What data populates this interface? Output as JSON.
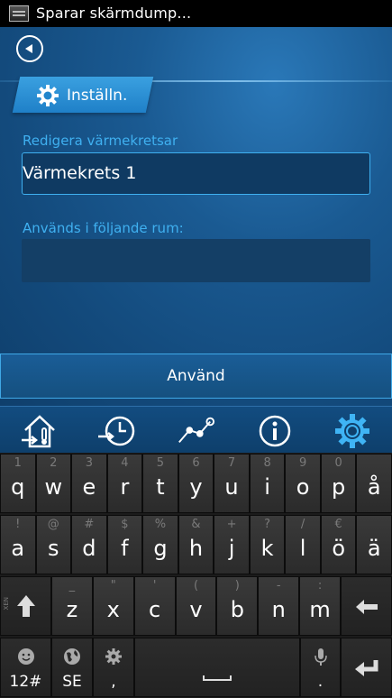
{
  "status_bar": {
    "notification_text": "Sparar skärmdump..."
  },
  "header": {
    "tab_label": "Inställn."
  },
  "form": {
    "edit_label": "Redigera värmekretsar",
    "circuit_name": "Värmekrets 1",
    "rooms_label": "Används i följande rum:",
    "rooms_value": ""
  },
  "apply_button": {
    "label": "Använd"
  },
  "nav": {
    "items": [
      {
        "icon": "house-thermometer-icon"
      },
      {
        "icon": "schedule-clock-icon"
      },
      {
        "icon": "graph-curve-icon"
      },
      {
        "icon": "info-icon"
      },
      {
        "icon": "settings-gear-icon",
        "active": true
      }
    ],
    "active_color": "#3fb4f5"
  },
  "keyboard": {
    "row1": [
      {
        "key": "q",
        "alt": "1"
      },
      {
        "key": "w",
        "alt": "2"
      },
      {
        "key": "e",
        "alt": "3"
      },
      {
        "key": "r",
        "alt": "4"
      },
      {
        "key": "t",
        "alt": "5"
      },
      {
        "key": "y",
        "alt": "6"
      },
      {
        "key": "u",
        "alt": "7"
      },
      {
        "key": "i",
        "alt": "8"
      },
      {
        "key": "o",
        "alt": "9"
      },
      {
        "key": "p",
        "alt": "0"
      },
      {
        "key": "å",
        "alt": ""
      }
    ],
    "row2": [
      {
        "key": "a",
        "alt": "!"
      },
      {
        "key": "s",
        "alt": "@"
      },
      {
        "key": "d",
        "alt": "#"
      },
      {
        "key": "f",
        "alt": "$"
      },
      {
        "key": "g",
        "alt": "%"
      },
      {
        "key": "h",
        "alt": "&"
      },
      {
        "key": "j",
        "alt": "+"
      },
      {
        "key": "k",
        "alt": "?"
      },
      {
        "key": "l",
        "alt": "/"
      },
      {
        "key": "ö",
        "alt": "€"
      },
      {
        "key": "ä",
        "alt": ""
      }
    ],
    "row3": [
      {
        "key": "z",
        "alt": "_"
      },
      {
        "key": "x",
        "alt": "\""
      },
      {
        "key": "c",
        "alt": "'"
      },
      {
        "key": "v",
        "alt": "("
      },
      {
        "key": "b",
        "alt": ")"
      },
      {
        "key": "n",
        "alt": "-"
      },
      {
        "key": "m",
        "alt": ":"
      }
    ],
    "shift_alt": "XEN",
    "symbols_label": "12#",
    "language_label": "SE",
    "comma_label": ",",
    "period_label": ".",
    "space_icon": "space-bar-icon",
    "mic_icon": "microphone-icon",
    "enter_icon": "enter-icon",
    "backspace_icon": "backspace-icon"
  }
}
